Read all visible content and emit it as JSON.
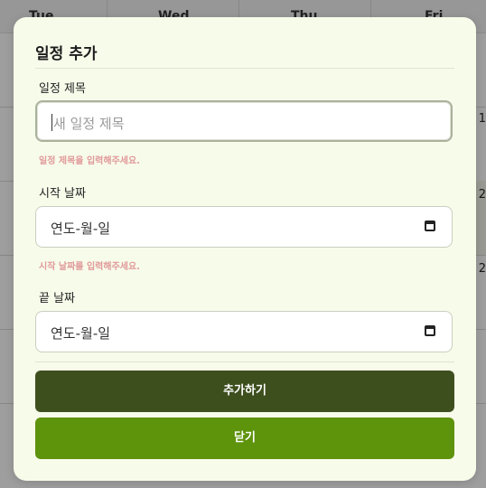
{
  "calendar": {
    "days": [
      "Tue",
      "Wed",
      "Thu",
      "Fri"
    ],
    "row_numbers": [
      "1",
      "2",
      "2"
    ]
  },
  "modal": {
    "title": "일정 추가",
    "title_field": {
      "label": "일정 제목",
      "placeholder": "새 일정 제목",
      "error": "일정 제목을 입력해주세요."
    },
    "start_date": {
      "label": "시작 날짜",
      "value": "연도-월-일",
      "error": "시작 날짜를 입력해주세요."
    },
    "end_date": {
      "label": "끝 날짜",
      "value": "연도-월-일"
    },
    "add_button": "추가하기",
    "close_button": "닫기"
  },
  "colors": {
    "modal_bg": "#f7fbea",
    "add_button": "#3e4f1e",
    "close_button": "#5e930c",
    "error_text": "#e19a9a"
  }
}
